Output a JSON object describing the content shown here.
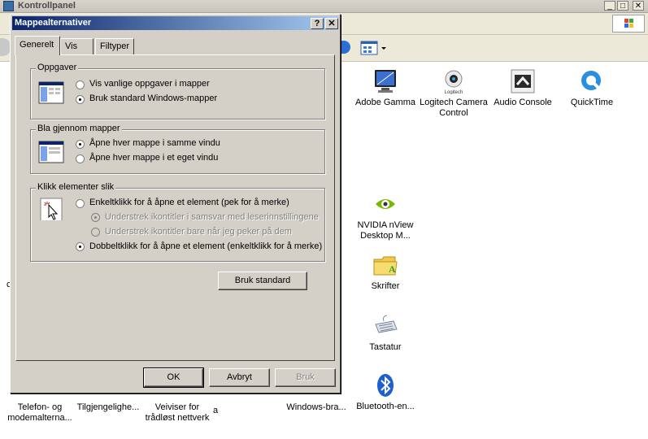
{
  "background_window": {
    "title": "Kontrollpanel",
    "items": [
      {
        "label": "Adobe Gamma",
        "icon": "monitor-icon"
      },
      {
        "label": "Logitech Camera Control",
        "icon": "logitech-icon"
      },
      {
        "label": "Audio Console",
        "icon": "audio-console-icon"
      },
      {
        "label": "QuickTime",
        "icon": "quicktime-icon"
      },
      {
        "label": "NVIDIA nView Desktop M...",
        "icon": "nvidia-icon"
      },
      {
        "label": "Skrifter",
        "icon": "fonts-folder-icon"
      },
      {
        "label": "Tastatur",
        "icon": "keyboard-icon"
      },
      {
        "label": "Bluetooth-en...",
        "icon": "bluetooth-icon"
      },
      {
        "label": "Windows-bra...",
        "icon": "windows-firewall-icon"
      },
      {
        "label": "Telefon- og modemalterna...",
        "icon": "phone-modem-icon"
      },
      {
        "label": "Tilgjengelighe...",
        "icon": "accessibility-icon"
      },
      {
        "label": "Veiviser for trådløst nettverk",
        "icon": "wireless-wizard-icon"
      },
      {
        "label": "a",
        "icon": ""
      },
      {
        "label": "c",
        "icon": ""
      }
    ]
  },
  "dialog": {
    "title": "Mappealternativer",
    "help_label": "?",
    "close_label": "✕",
    "tabs": [
      "Generelt",
      "Vis",
      "Filtyper"
    ],
    "groups": {
      "tasks": {
        "label": "Oppgaver",
        "options": [
          {
            "label": "Vis vanlige oppgaver i mapper",
            "checked": false,
            "enabled": true
          },
          {
            "label": "Bruk standard Windows-mapper",
            "checked": true,
            "enabled": true
          }
        ]
      },
      "browse": {
        "label": "Bla gjennom mapper",
        "options": [
          {
            "label": "Åpne hver mappe i samme vindu",
            "checked": true,
            "enabled": true
          },
          {
            "label": "Åpne hver mappe i et eget vindu",
            "checked": false,
            "enabled": true
          }
        ]
      },
      "click": {
        "label": "Klikk elementer slik",
        "options": [
          {
            "label": "Enkeltklikk for å åpne et element (pek for å merke)",
            "checked": false,
            "enabled": true
          },
          {
            "label": "Understrek ikontitler i samsvar med leserinnstillingene",
            "checked": true,
            "enabled": false
          },
          {
            "label": "Understrek ikontitler bare når jeg peker på dem",
            "checked": false,
            "enabled": false
          },
          {
            "label": "Dobbeltklikk for å åpne et element (enkeltklikk for å merke)",
            "checked": true,
            "enabled": true
          }
        ]
      }
    },
    "restore_defaults_label": "Bruk standard",
    "ok_label": "OK",
    "cancel_label": "Avbryt",
    "apply_label": "Bruk"
  }
}
